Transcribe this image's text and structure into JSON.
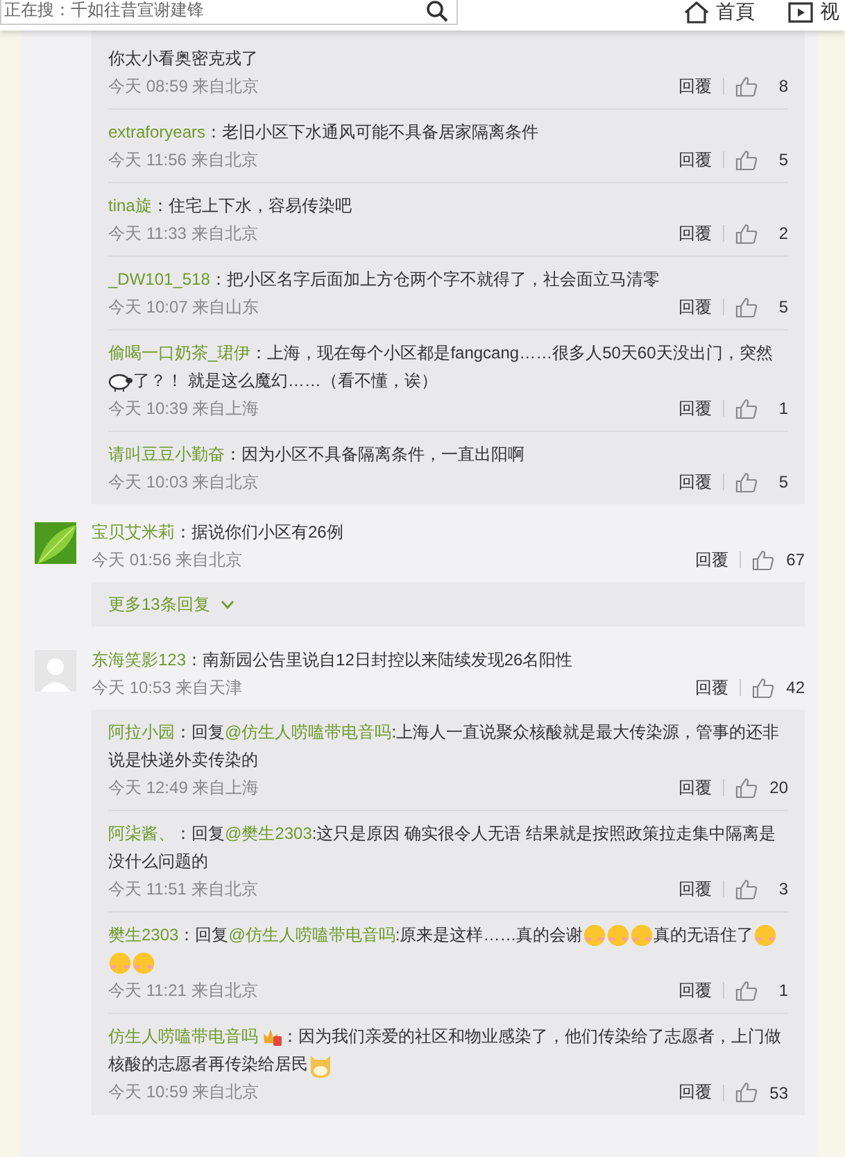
{
  "header": {
    "search": {
      "placeholder": "正在搜：千如往昔宣谢建锋"
    },
    "nav": [
      {
        "label": "首頁",
        "kind": "home"
      },
      {
        "label": "视",
        "kind": "video"
      }
    ]
  },
  "threads": [
    {
      "replies": [
        {
          "parts": [
            {
              "kind": "text",
              "text": "你太小看奥密克戎了"
            }
          ],
          "time": "今天 08:59 来自北京",
          "reply": "回覆",
          "likes": "8"
        },
        {
          "author": "extraforyears",
          "parts": [
            {
              "kind": "text",
              "text": "：老旧小区下水通风可能不具备居家隔离条件"
            }
          ],
          "time": "今天 11:56 来自北京",
          "reply": "回覆",
          "likes": "5"
        },
        {
          "author": "tina旋",
          "parts": [
            {
              "kind": "text",
              "text": "：住宅上下水，容易传染吧"
            }
          ],
          "time": "今天 11:33 来自北京",
          "reply": "回覆",
          "likes": "2"
        },
        {
          "author": "_DW101_518",
          "parts": [
            {
              "kind": "text",
              "text": "：把小区名字后面加上方仓两个字不就得了，社会面立马清零"
            }
          ],
          "time": "今天 10:07 来自山东",
          "reply": "回覆",
          "likes": "5"
        },
        {
          "author": "偷喝一口奶茶_珺伊",
          "parts": [
            {
              "kind": "text",
              "text": "：上海，现在每个小区都是fangcang……很多人50天60天没出门，突然"
            },
            {
              "kind": "sheep"
            },
            {
              "kind": "text",
              "text": "了？！ 就是这么魔幻……（看不懂，诶）"
            }
          ],
          "time": "今天 10:39 来自上海",
          "reply": "回覆",
          "likes": "1"
        },
        {
          "author": "请叫豆豆小勤奋",
          "parts": [
            {
              "kind": "text",
              "text": "：因为小区不具备隔离条件，一直出阳啊"
            }
          ],
          "time": "今天 10:03 来自北京",
          "reply": "回覆",
          "likes": "5"
        }
      ]
    },
    {
      "comment": {
        "author": "宝贝艾米莉",
        "text": "：据说你们小区有26例",
        "time": "今天 01:56 来自北京",
        "reply": "回覆",
        "likes": "67"
      },
      "more": "更多13条回复"
    },
    {
      "comment": {
        "author": "东海笑影123",
        "avatar": {
          "kind": "silhouette"
        },
        "text": "：南新园公告里说自12日封控以来陆续发现26名阳性",
        "time": "今天 10:53 来自天津",
        "reply": "回覆",
        "likes": "42"
      },
      "replies": [
        {
          "author": "阿拉小园",
          "parts": [
            {
              "kind": "text",
              "text": "：回复"
            },
            {
              "kind": "mention",
              "text": "@仿生人唠嗑带电音吗"
            },
            {
              "kind": "text",
              "text": ":上海人一直说聚众核酸就是最大传染源，管事的还非说是快递外卖传染的"
            }
          ],
          "time": "今天 12:49 来自上海",
          "reply": "回覆",
          "likes": "20"
        },
        {
          "author": "阿柒酱、",
          "parts": [
            {
              "kind": "text",
              "text": "：回复"
            },
            {
              "kind": "mention",
              "text": "@樊生2303"
            },
            {
              "kind": "text",
              "text": ":这只是原因 确实很令人无语 结果就是按照政策拉走集中隔离是没什么问题的"
            }
          ],
          "time": "今天 11:51 来自北京",
          "reply": "回覆",
          "likes": "3"
        },
        {
          "author": "樊生2303",
          "parts": [
            {
              "kind": "text",
              "text": "：回复"
            },
            {
              "kind": "mention",
              "text": "@仿生人唠嗑带电音吗"
            },
            {
              "kind": "text",
              "text": ":原来是这样……真的会谢"
            },
            {
              "kind": "emoji"
            },
            {
              "kind": "emoji"
            },
            {
              "kind": "emoji"
            },
            {
              "kind": "text",
              "text": "真的无语住了"
            },
            {
              "kind": "emoji"
            },
            {
              "kind": "emoji"
            },
            {
              "kind": "emoji"
            }
          ],
          "time": "今天 11:21 来自北京",
          "reply": "回覆",
          "likes": "1"
        },
        {
          "author": "仿生人唠嗑带电音吗",
          "badge": true,
          "parts": [
            {
              "kind": "text",
              "text": "：因为我们亲爱的社区和物业感染了，他们传染给了志愿者，上门做核酸的志愿者再传染给居民"
            },
            {
              "kind": "cat"
            }
          ],
          "time": "今天 10:59 来自北京",
          "reply": "回覆",
          "likes": "53"
        }
      ]
    }
  ]
}
